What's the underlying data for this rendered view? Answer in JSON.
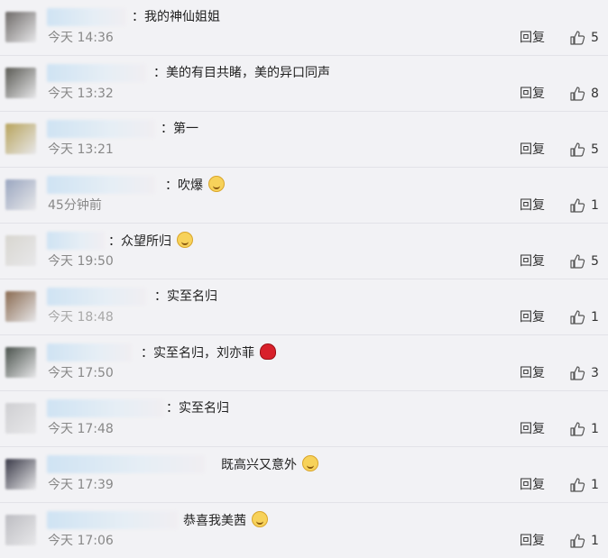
{
  "reply_label": "回复",
  "comments": [
    {
      "comment": "：我的神仙姐姐",
      "time": "今天 14:36",
      "likes": "5",
      "avatar_color": "#6e6a68",
      "emoji": ""
    },
    {
      "comment": "：美的有目共睹，美的异口同声",
      "time": "今天 13:32",
      "likes": "8",
      "avatar_color": "#5a5a54",
      "emoji": ""
    },
    {
      "comment": "：第一",
      "time": "今天 13:21",
      "likes": "5",
      "avatar_color": "#b8a45c",
      "emoji": ""
    },
    {
      "comment": "：吹爆",
      "time": "45分钟前",
      "likes": "1",
      "avatar_color": "#9aa6c0",
      "emoji": "grin-icon"
    },
    {
      "comment": "：众望所归",
      "time": "今天 19:50",
      "likes": "5",
      "avatar_color": "#d8d6d0",
      "emoji": "cat-icon"
    },
    {
      "comment": "：实至名归",
      "time": "今天 18:48",
      "likes": "1",
      "avatar_color": "#8a6a50",
      "emoji": ""
    },
    {
      "comment": "：实至名归，刘亦菲",
      "time": "今天 17:50",
      "likes": "3",
      "avatar_color": "#4a524c",
      "emoji": "rose-icon"
    },
    {
      "comment": "：实至名归",
      "time": "今天 17:48",
      "likes": "1",
      "avatar_color": "#cfcfd2",
      "emoji": ""
    },
    {
      "comment": "既高兴又意外",
      "time": "今天 17:39",
      "likes": "1",
      "avatar_color": "#3a3a48",
      "emoji": "laugh-icon"
    },
    {
      "comment": "恭喜我美茜",
      "time": "今天 17:06",
      "likes": "1",
      "avatar_color": "#bdbdc2",
      "emoji": "kiss-icon"
    }
  ]
}
